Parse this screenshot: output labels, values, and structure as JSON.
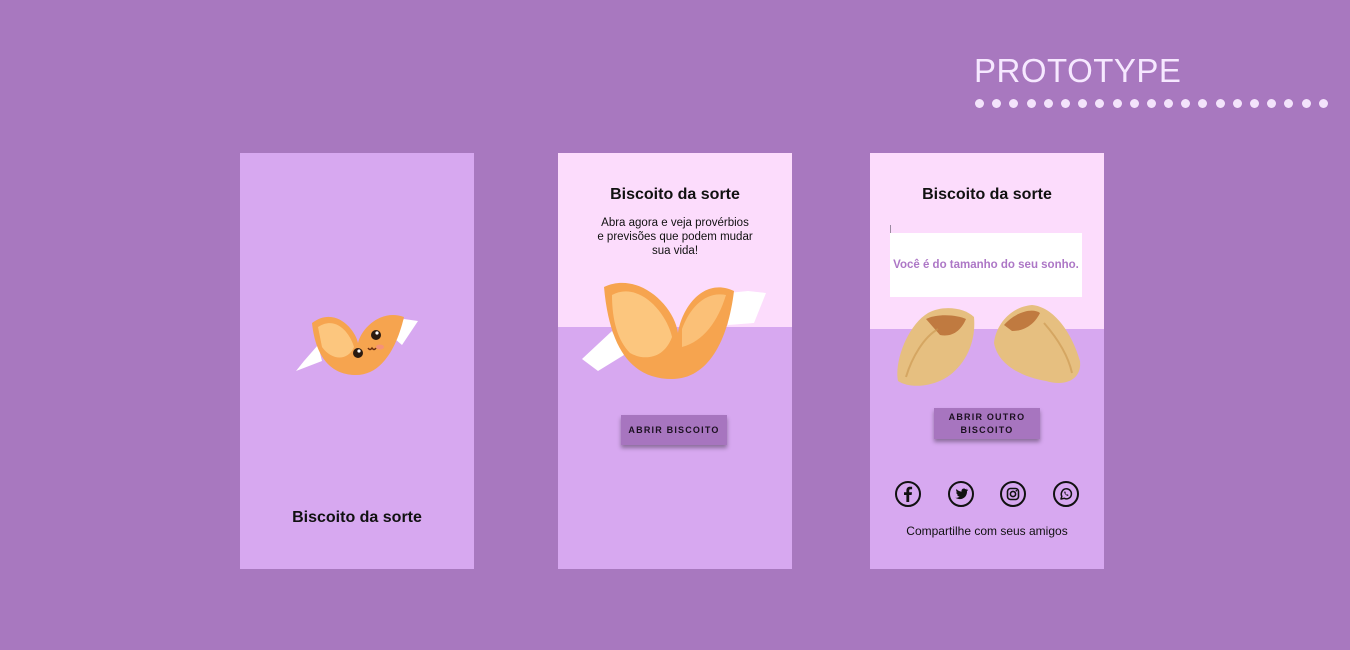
{
  "header": {
    "title": "PROTOTYPE"
  },
  "screen1": {
    "app_title": "Biscoito da sorte"
  },
  "screen2": {
    "app_title": "Biscoito da sorte",
    "subtitle_lines": [
      "Abra agora e veja provérbios",
      "e previsões que podem mudar",
      "sua vida!"
    ],
    "button_label": "ABRIR BISCOITO"
  },
  "screen3": {
    "app_title": "Biscoito da sorte",
    "fortune_message": "Você é do tamanho do seu sonho.",
    "button_label_lines": [
      "ABRIR OUTRO",
      "BISCOITO"
    ],
    "share_icons": [
      "facebook-icon",
      "twitter-icon",
      "instagram-icon",
      "whatsapp-icon"
    ],
    "share_text": "Compartilhe com seus amigos"
  },
  "colors": {
    "background": "#a878bf",
    "screen": "#d7a8f0",
    "screen_top": "#fcdcfc",
    "button": "#a775bf",
    "message_text": "#ad77c6",
    "cookie_orange": "#f6a44f",
    "cookie_light": "#fcc67e"
  }
}
